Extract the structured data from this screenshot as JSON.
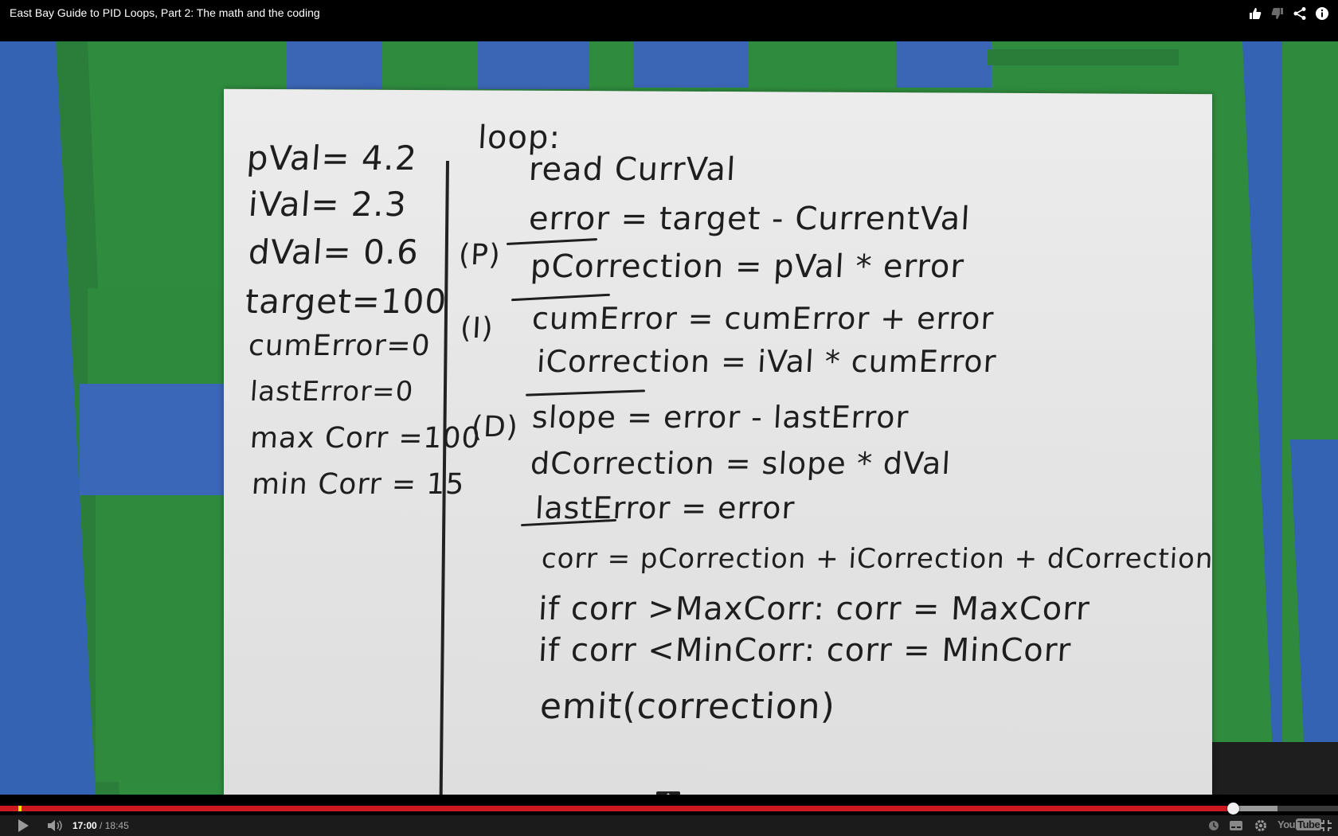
{
  "window": {
    "title": "East Bay Guide to PID Loops, Part 2: The math and the coding"
  },
  "top_icons": [
    "thumbs-up-icon",
    "thumbs-down-icon",
    "share-icon",
    "info-icon"
  ],
  "whiteboard": {
    "variables": [
      "pVal= 4.2",
      "iVal= 2.3",
      "dVal= 0.6",
      "target=100",
      "cumError=0",
      "lastError=0",
      "max Corr =100",
      "min Corr = 15"
    ],
    "loop_label": "loop:",
    "section_markers": [
      "(P)",
      "(I)",
      "(D)"
    ],
    "code_lines": [
      "read CurrVal",
      "error = target - CurrentVal",
      "pCorrection = pVal * error",
      "cumError = cumError + error",
      "iCorrection = iVal * cumError",
      "slope = error - lastError",
      "dCorrection = slope * dVal",
      "lastError = error",
      "corr = pCorrection + iCorrection + dCorrection",
      "if corr >MaxCorr: corr = MaxCorr",
      "if corr <MinCorr: corr = MinCorr",
      "emit(correction)"
    ]
  },
  "player": {
    "current_time": "17:00",
    "separator": " / ",
    "duration": "18:45",
    "played_fraction": 0.9212,
    "loaded_fraction": 0.9545,
    "logo_you": "You",
    "logo_tube": "Tube",
    "colors": {
      "played": "#cc181e",
      "loaded": "#9a9a9a",
      "track": "#3a3a3a",
      "marker": "#f3e600"
    }
  }
}
